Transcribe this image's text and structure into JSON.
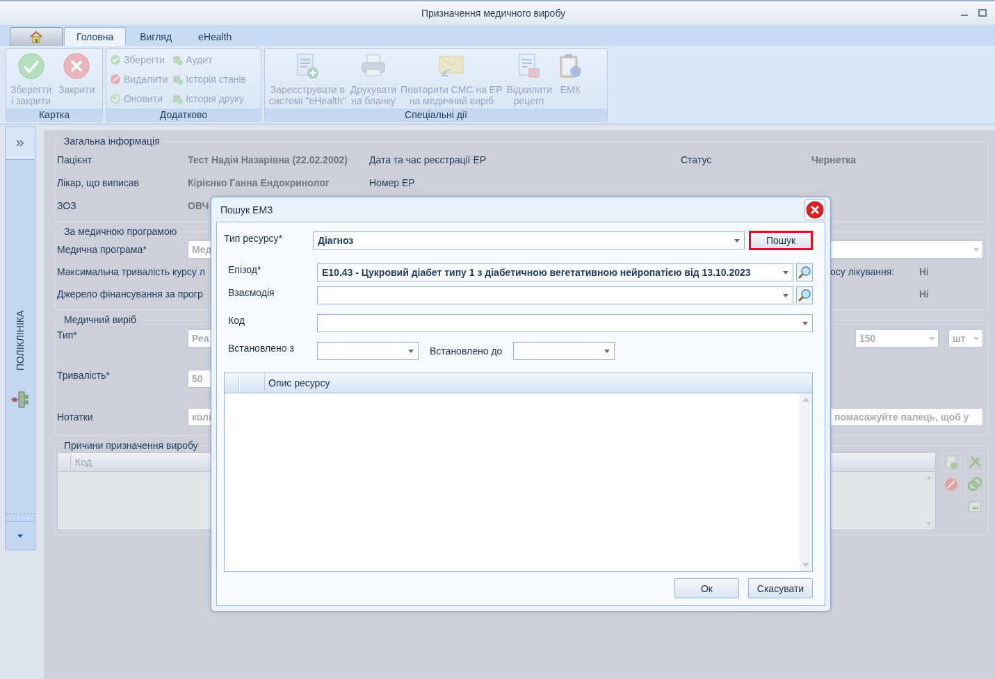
{
  "window": {
    "title": "Призначення медичного виробу"
  },
  "ribbon_tabs": [
    {
      "kind": "home",
      "selected": false
    },
    {
      "kind": "text",
      "label": "Головна",
      "selected": true
    },
    {
      "kind": "text",
      "label": "Вигляд",
      "selected": false
    },
    {
      "kind": "text",
      "label": "eHealth",
      "selected": false
    }
  ],
  "ribbon_groups": [
    {
      "title": "Картка",
      "buttons": [
        {
          "kind": "large",
          "label": "Зберегти\nі закрити",
          "disabled": true
        },
        {
          "kind": "large",
          "label": "Закрити",
          "disabled": true
        }
      ]
    },
    {
      "title": "Додатково",
      "buttons": [
        {
          "kind": "small",
          "label": "Зберегти",
          "disabled": true
        },
        {
          "kind": "small",
          "label": "Видалити",
          "disabled": true
        },
        {
          "kind": "small",
          "label": "Оновити",
          "disabled": true
        },
        {
          "kind": "small",
          "label": "Аудит",
          "disabled": true
        },
        {
          "kind": "small",
          "label": "Історія станів",
          "disabled": true
        },
        {
          "kind": "small",
          "label": "Історія друку",
          "disabled": true
        }
      ]
    },
    {
      "title": "Спеціальні дії",
      "buttons": [
        {
          "kind": "large",
          "label": "Зареєструвати в\nсистемі \"eHealth\"",
          "disabled": true
        },
        {
          "kind": "large",
          "label": "Друкувати\nна бланку",
          "disabled": true
        },
        {
          "kind": "large",
          "label": "Повторити СМС на ЕР\nна медичний виріб",
          "disabled": true
        },
        {
          "kind": "large",
          "label": "Відхилити\nрецепт",
          "disabled": true
        },
        {
          "kind": "large",
          "label": "ЕМК",
          "disabled": true
        }
      ]
    }
  ],
  "side_panel": {
    "title": "ПОЛІКЛІНІКА"
  },
  "general_info": {
    "title": "Загальна інформація",
    "patient_label": "Пацієнт",
    "patient": "Тест Надія Назарівна (22.02.2002)",
    "registered_label": "Дата та час реєстрації ЕР",
    "status_label": "Статус",
    "status": "Чернетка",
    "doctor_label": "Лікар, що виписав",
    "doctor": "Кірієнко Ганна Ендокринолог",
    "number_label": "Номер ЕР",
    "facility_label": "ЗОЗ",
    "facility": "ОВЧ"
  },
  "program": {
    "title": "За медичною програмою",
    "program_label": "Медична програма*",
    "program_value": "Мед",
    "max_duration_label": "Максимальна тривалість курсу л",
    "course_label": "осу лікування:",
    "course_value": "Ні",
    "funding_label": "Джерело фінансування за прогр",
    "funding_value": "Ні"
  },
  "device": {
    "title": "Медичний виріб",
    "type_label": "Тип*",
    "type_value": "Реа",
    "quantity": "150",
    "unit": "шт",
    "duration_label": "Тривалість*",
    "duration_value": "50",
    "notes_label": "Нотатки",
    "notes_value": "колі",
    "notes_tail": "помасажуйте палець, щоб у"
  },
  "reasons": {
    "title": "Причини призначення виробу",
    "columns": [
      "Код"
    ]
  },
  "dialog": {
    "title": "Пошук ЕМЗ",
    "resource_type": {
      "label": "Тип ресурсу*",
      "value": "Діагноз"
    },
    "search_button": {
      "label": "Пошук",
      "highlighted": true
    },
    "episode": {
      "label": "Епізод*",
      "value": "E10.43 - Цукровий діабет типу 1 з діабетичною вегетативною нейропатією від 13.10.2023"
    },
    "interaction": {
      "label": "Взаємодія"
    },
    "code": {
      "label": "Код"
    },
    "date_from": {
      "label": "Встановлено з"
    },
    "date_to": {
      "label": "Встановлено до"
    },
    "grid": {
      "columns": [
        "Опис ресурсу"
      ]
    },
    "buttons": [
      {
        "label": "Ок"
      },
      {
        "label": "Скасувати"
      }
    ]
  }
}
